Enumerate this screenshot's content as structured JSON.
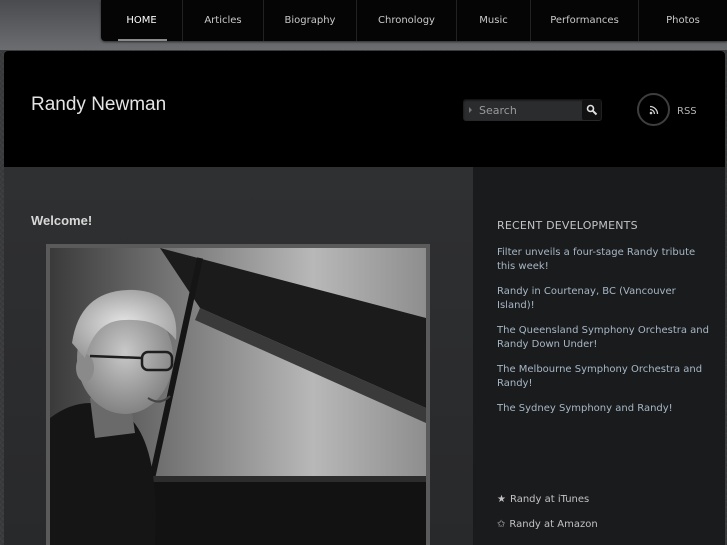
{
  "nav": {
    "items": [
      {
        "label": "HOME",
        "active": true,
        "width": 82
      },
      {
        "label": "Articles",
        "width": 81
      },
      {
        "label": "Biography",
        "width": 93
      },
      {
        "label": "Chronology",
        "width": 100
      },
      {
        "label": "Music",
        "width": 74
      },
      {
        "label": "Performances",
        "width": 108
      },
      {
        "label": "Photos",
        "width": 88
      }
    ]
  },
  "header": {
    "site_title": "Randy Newman",
    "search_placeholder": "Search",
    "rss_label": "RSS"
  },
  "main": {
    "heading": "Welcome!"
  },
  "sidebar": {
    "heading": "RECENT DEVELOPMENTS",
    "news": [
      "Filter unveils a four-stage Randy tribute this week!",
      "Randy in Courtenay, BC (Vancouver Island)!",
      "The Queensland Symphony Orchestra and Randy Down Under!",
      "The Melbourne Symphony Orchestra and Randy!",
      "The Sydney Symphony and Randy!"
    ],
    "links": [
      {
        "icon": "★",
        "label": "Randy at iTunes"
      },
      {
        "icon": "✩",
        "label": "Randy at Amazon"
      }
    ]
  },
  "colors": {
    "nav_bg": "#050505",
    "header_bg": "#000000",
    "sidebar_bg": "#1a1b1d",
    "news_link": "#a7b7c6"
  }
}
